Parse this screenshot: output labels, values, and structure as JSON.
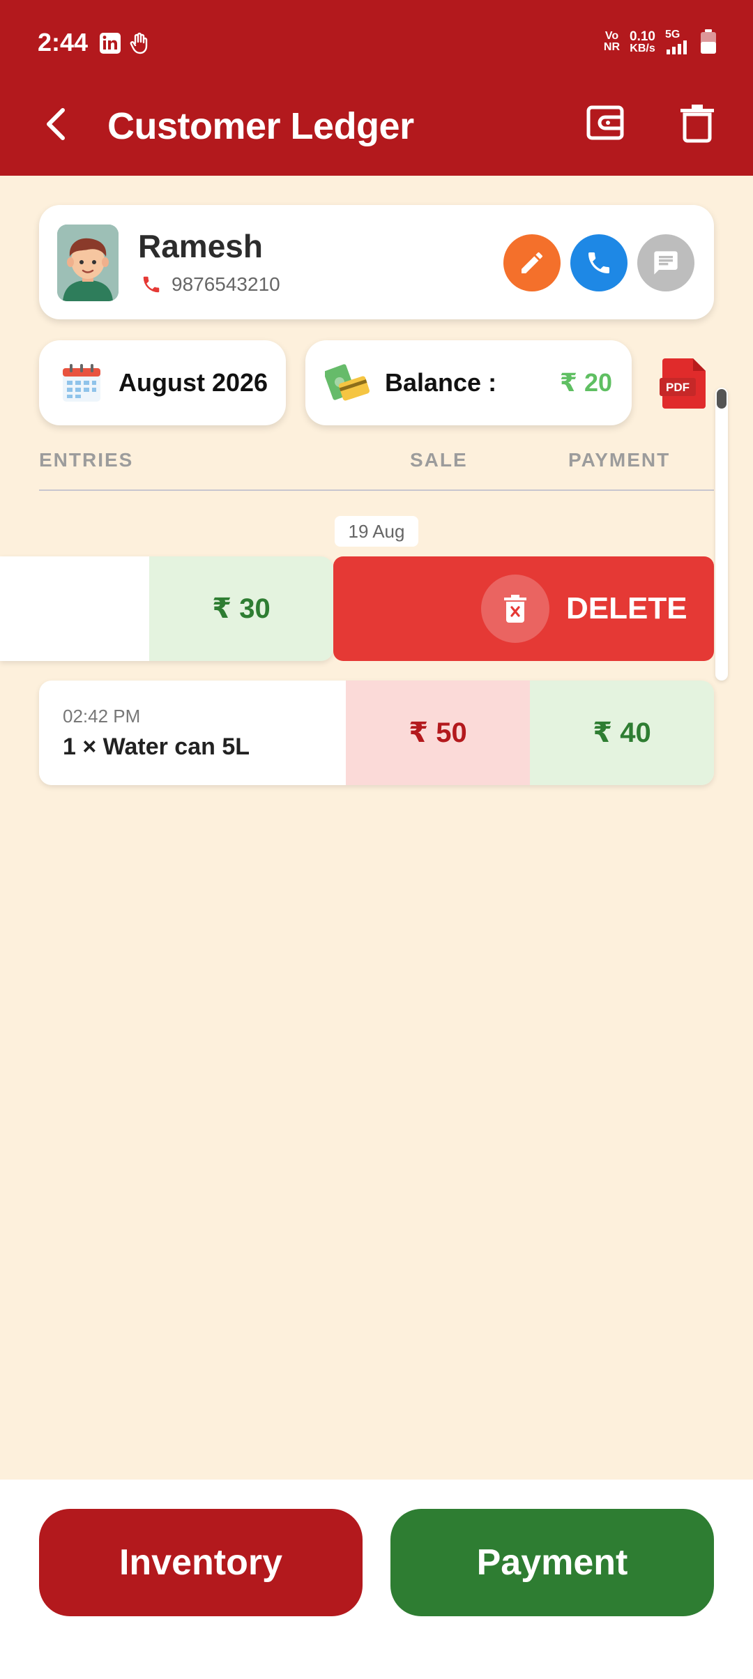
{
  "status": {
    "time": "2:44",
    "net_left_top": "Vo",
    "net_left_bottom": "NR",
    "speed_top": "0.10",
    "speed_bottom": "KB/s",
    "network": "5G"
  },
  "appbar": {
    "title": "Customer Ledger",
    "back_icon": "arrow-left-icon",
    "wallet_icon": "wallet-icon",
    "delete_icon": "trash-icon"
  },
  "customer": {
    "name": "Ramesh",
    "phone": "9876543210"
  },
  "period": {
    "month": "August 2026"
  },
  "balance": {
    "label": "Balance :",
    "value": "₹ 20"
  },
  "columns": {
    "entries": "ENTRIES",
    "sale": "SALE",
    "payment": "PAYMENT"
  },
  "date_group": "19 Aug",
  "swiped_entry": {
    "payment": "₹ 30",
    "delete_label": "DELETE"
  },
  "entry": {
    "time": "02:42 PM",
    "item": "1 × Water can 5L",
    "sale": "₹ 50",
    "payment": "₹ 40"
  },
  "actions": {
    "inventory": "Inventory",
    "payment": "Payment"
  },
  "colors": {
    "primary": "#b3191d",
    "background": "#fdf0dc",
    "positive": "#2e7d32",
    "delete": "#e53935"
  }
}
